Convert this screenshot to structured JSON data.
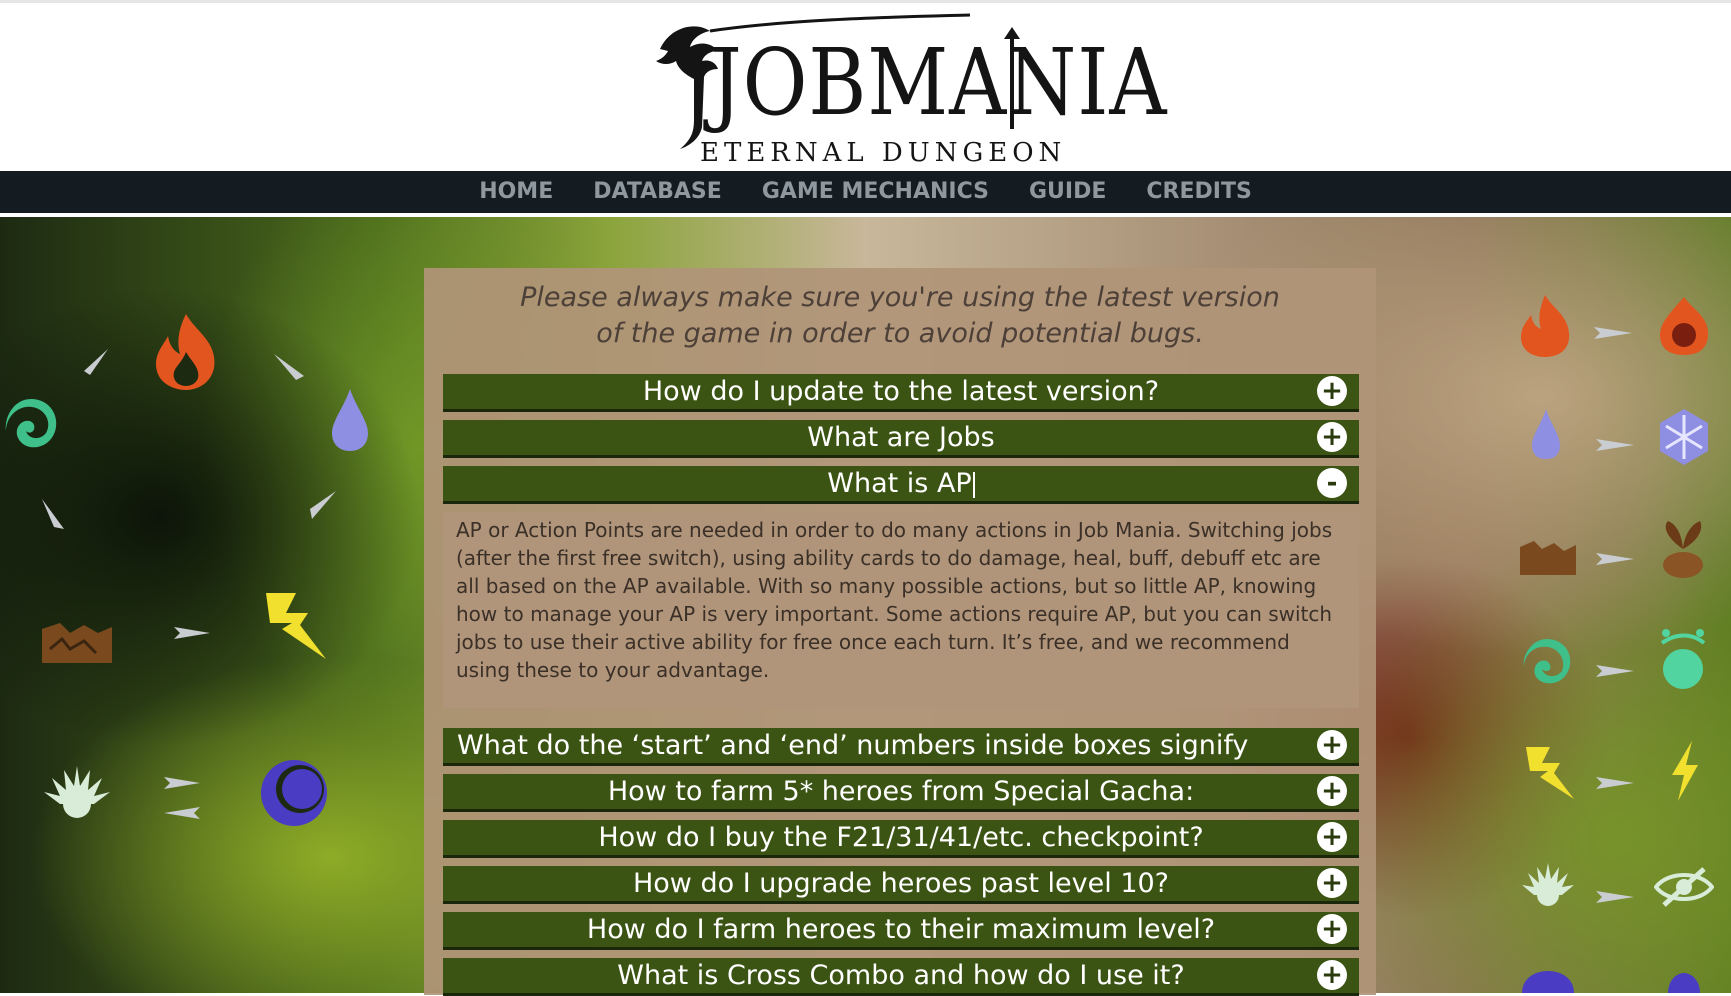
{
  "logo": {
    "title": "JOBMANIA",
    "subtitle": "ETERNAL DUNGEON"
  },
  "nav": {
    "items": [
      "HOME",
      "DATABASE",
      "GAME MECHANICS",
      "GUIDE",
      "CREDITS"
    ]
  },
  "notice": {
    "line1": "Please always make sure you're using the latest version",
    "line2": "of the game in order to avoid potential bugs."
  },
  "faq": [
    {
      "question": "How do I update to the latest version?",
      "toggle": "+"
    },
    {
      "question": "What are Jobs",
      "toggle": "+"
    },
    {
      "question": "What is AP",
      "toggle": "-",
      "answer": "AP or Action Points are needed in order to do many actions in Job Mania. Switching jobs (after the first free switch), using ability cards to do damage, heal, buff, debuff etc are all based on the AP available. With so many possible actions, but so little AP, knowing how to manage your AP is very important. Some actions require AP, but you can switch jobs to use their active ability for free once each turn. It’s free, and we recommend using these to your advantage."
    },
    {
      "question": "What do the ‘start’ and ‘end’ numbers inside boxes signify",
      "toggle": "+"
    },
    {
      "question": "How to farm 5* heroes from Special Gacha:",
      "toggle": "+"
    },
    {
      "question": "How do I buy the F21/31/41/etc. checkpoint?",
      "toggle": "+"
    },
    {
      "question": "How do I upgrade heroes past level 10?",
      "toggle": "+"
    },
    {
      "question": "How do I farm heroes to their maximum level?",
      "toggle": "+"
    },
    {
      "question": "What is Cross Combo and how do I use it?",
      "toggle": "+"
    }
  ],
  "colors": {
    "nav_bg": "#141c22",
    "nav_text": "#8f989f",
    "faq_bar": "#3b5313",
    "panel": "#b0957a"
  },
  "icons": {
    "left": [
      "fire-icon",
      "wind-icon",
      "water-icon",
      "earth-icon",
      "lightning-icon",
      "light-icon",
      "dark-icon",
      "arrow-icon"
    ],
    "right": [
      "fire-icon",
      "skull-fire-icon",
      "water-icon",
      "snowflake-icon",
      "earth-icon",
      "sprout-icon",
      "wind-icon",
      "dizzy-icon",
      "lightning-icon",
      "bolt-icon",
      "light-icon",
      "blind-icon",
      "dark-icon"
    ]
  }
}
